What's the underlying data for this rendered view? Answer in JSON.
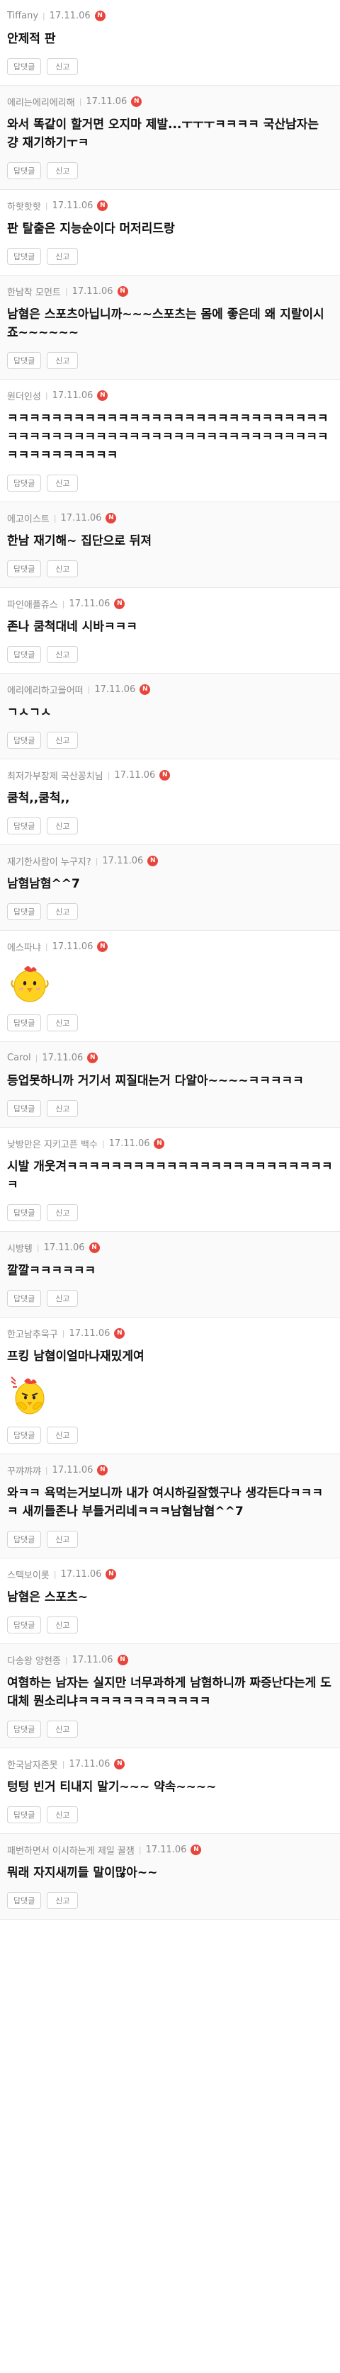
{
  "new_badge": "N",
  "buttons": {
    "reply": "답댓글",
    "report": "신고"
  },
  "comments": [
    {
      "nick": "Tiffany",
      "date": "17.11.06",
      "text": "안제적 판"
    },
    {
      "nick": "에리는에리에리해",
      "date": "17.11.06",
      "text": "와서 똑같이 할거면 오지마 제발...ㅜㅜㅜㅋㅋㅋㅋ 국산남자는 걍 재기하기ㅜㅋ"
    },
    {
      "nick": "하핫핫핫",
      "date": "17.11.06",
      "text": "판 탈출은 지능순이다 머저리드랑"
    },
    {
      "nick": "한남착 모먼트",
      "date": "17.11.06",
      "text": "남혐은 스포츠아닙니까~~~스포츠는 몸에 좋은데 왜 지랄이시죠~~~~~~"
    },
    {
      "nick": "원더인성",
      "date": "17.11.06",
      "text": "ㅋㅋㅋㅋㅋㅋㅋㅋㅋㅋㅋㅋㅋㅋㅋㅋㅋㅋㅋㅋㅋㅋㅋㅋㅋㅋㅋㅋㅋㅋㅋㅋㅋㅋㅋㅋㅋㅋㅋㅋㅋㅋㅋㅋㅋㅋㅋㅋㅋㅋㅋㅋㅋㅋㅋㅋㅋㅋㅋㅋㅋㅋㅋㅋㅋㅋㅋㅋ"
    },
    {
      "nick": "에고이스트",
      "date": "17.11.06",
      "text": "한남 재기해~ 집단으로 뒤져"
    },
    {
      "nick": "파인애플쥬스",
      "date": "17.11.06",
      "text": "존나 쿰척대네 시바ㅋㅋㅋ"
    },
    {
      "nick": "에리에리하고을어떠",
      "date": "17.11.06",
      "text": "ㄱㅅㄱㅅ"
    },
    {
      "nick": "최저가부장제 국산꽁치님",
      "date": "17.11.06",
      "text": "쿰척,,쿰척,,"
    },
    {
      "nick": "재기한사람이 누구지?",
      "date": "17.11.06",
      "text": "남혐남혐^^7"
    },
    {
      "nick": "에스파냐",
      "date": "17.11.06",
      "text": ""
    },
    {
      "nick": "Carol",
      "date": "17.11.06",
      "text": "등업못하니까 거기서 찌질대는거 다알아~~~~ㅋㅋㅋㅋㅋ"
    },
    {
      "nick": "낮방만은 지키고픈 백수",
      "date": "17.11.06",
      "text": "시발 개웃겨ㅋㅋㅋㅋㅋㅋㅋㅋㅋㅋㅋㅋㅋㅋㅋㅋㅋㅋㅋㅋㅋㅋㅋㅋㅋ"
    },
    {
      "nick": "시방텡",
      "date": "17.11.06",
      "text": "깔깔ㅋㅋㅋㅋㅋㅋ"
    },
    {
      "nick": "한고남추욱구",
      "date": "17.11.06",
      "text": "프킹 남혐이얼마나재밌게여"
    },
    {
      "nick": "꾸꺄꺄꺄",
      "date": "17.11.06",
      "text": "와ㅋㅋ 욕먹는거보니까 내가 여시하길잘했구나 생각든다ㅋㅋㅋㅋ 새끼들존나 부들거리네ㅋㅋㅋ남혐남혐^^7"
    },
    {
      "nick": "스텍보이롯",
      "date": "17.11.06",
      "text": "남혐은 스포츠~"
    },
    {
      "nick": "다송왕 양현종",
      "date": "17.11.06",
      "text": "여혐하는 남자는 실지만 너무과하게 남혐하니까 짜증난다는게 도대체 뭔소리냐ㅋㅋㅋㅋㅋㅋㅋㅋㅋㅋㅋㅋ"
    },
    {
      "nick": "한국남자존못",
      "date": "17.11.06",
      "text": "텅텅 빈거 티내지 말기~~~ 약속~~~~"
    },
    {
      "nick": "패번하면서 이시하는게 제일 꿀잼",
      "date": "17.11.06",
      "text": "뭐래 자지새끼들 말이많아~~"
    }
  ]
}
